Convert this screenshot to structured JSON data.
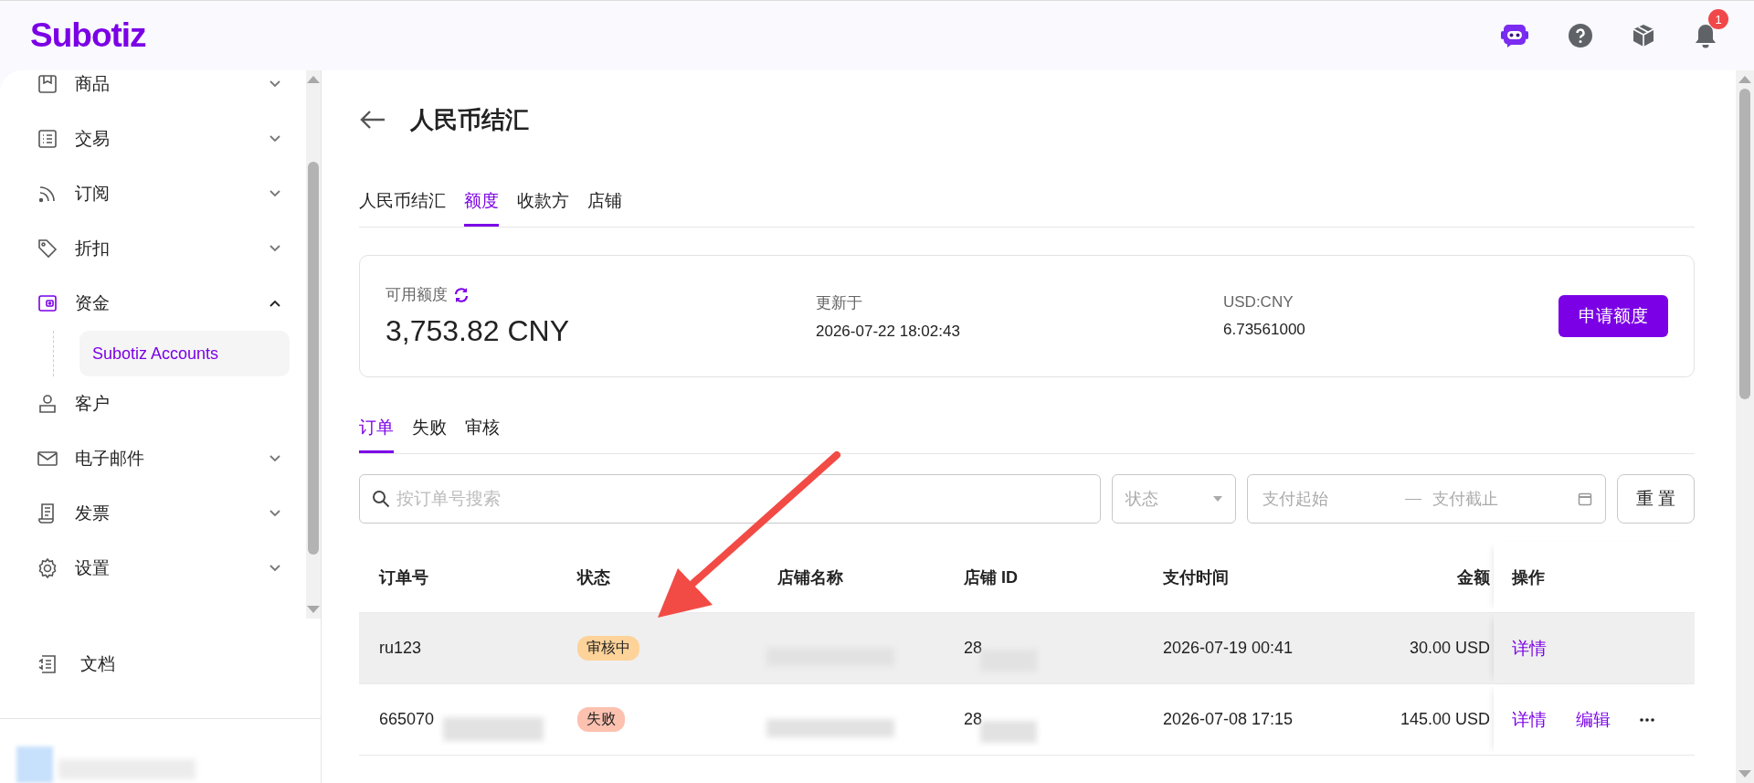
{
  "header": {
    "logo": "Subotiz",
    "notifications": {
      "count": "1"
    }
  },
  "sidebar": {
    "items": [
      {
        "label": "商品",
        "expanded": false
      },
      {
        "label": "交易",
        "expanded": false
      },
      {
        "label": "订阅",
        "expanded": false
      },
      {
        "label": "折扣",
        "expanded": false
      },
      {
        "label": "资金",
        "expanded": true,
        "selected": true,
        "children": [
          {
            "label": "Subotiz Accounts",
            "selected": true
          }
        ]
      },
      {
        "label": "客户"
      },
      {
        "label": "电子邮件",
        "expanded": false
      },
      {
        "label": "发票",
        "expanded": false
      },
      {
        "label": "设置",
        "expanded": false
      }
    ],
    "footer_item": {
      "label": "文档"
    }
  },
  "page": {
    "title": "人民币结汇",
    "tabs": [
      {
        "label": "人民币结汇",
        "selected": false
      },
      {
        "label": "额度",
        "selected": true
      },
      {
        "label": "收款方",
        "selected": false
      },
      {
        "label": "店铺",
        "selected": false
      }
    ],
    "summary": {
      "available_label": "可用额度",
      "available_value": "3,753.82 CNY",
      "updated_label": "更新于",
      "updated_value": "2026-07-22 18:02:43",
      "rate_label": "USD:CNY",
      "rate_value": "6.73561000",
      "apply_button": "申请额度"
    },
    "subtabs": [
      {
        "label": "订单",
        "selected": true
      },
      {
        "label": "失败",
        "selected": false
      },
      {
        "label": "审核",
        "selected": false
      }
    ],
    "filters": {
      "search_placeholder": "按订单号搜索",
      "status_placeholder": "状态",
      "start_placeholder": "支付起始",
      "end_placeholder": "支付截止",
      "reset_button": "重 置"
    },
    "table": {
      "columns": [
        "订单号",
        "状态",
        "店铺名称",
        "店铺 ID",
        "支付时间",
        "金额",
        "操作"
      ],
      "rows": [
        {
          "order_id": "ru123",
          "status": {
            "label": "审核中",
            "kind": "review"
          },
          "store_id": "28",
          "paid_at": "2026-07-19 00:41",
          "amount": "30.00 USD",
          "actions": [
            {
              "label": "详情",
              "kind": "link"
            }
          ],
          "selected": true
        },
        {
          "order_id": "665070",
          "status": {
            "label": "失败",
            "kind": "failed"
          },
          "store_id": "28",
          "paid_at": "2026-07-08 17:15",
          "amount": "145.00 USD",
          "actions": [
            {
              "label": "详情",
              "kind": "link"
            },
            {
              "label": "编辑",
              "kind": "link"
            },
            {
              "kind": "more"
            }
          ],
          "selected": false
        }
      ]
    }
  }
}
